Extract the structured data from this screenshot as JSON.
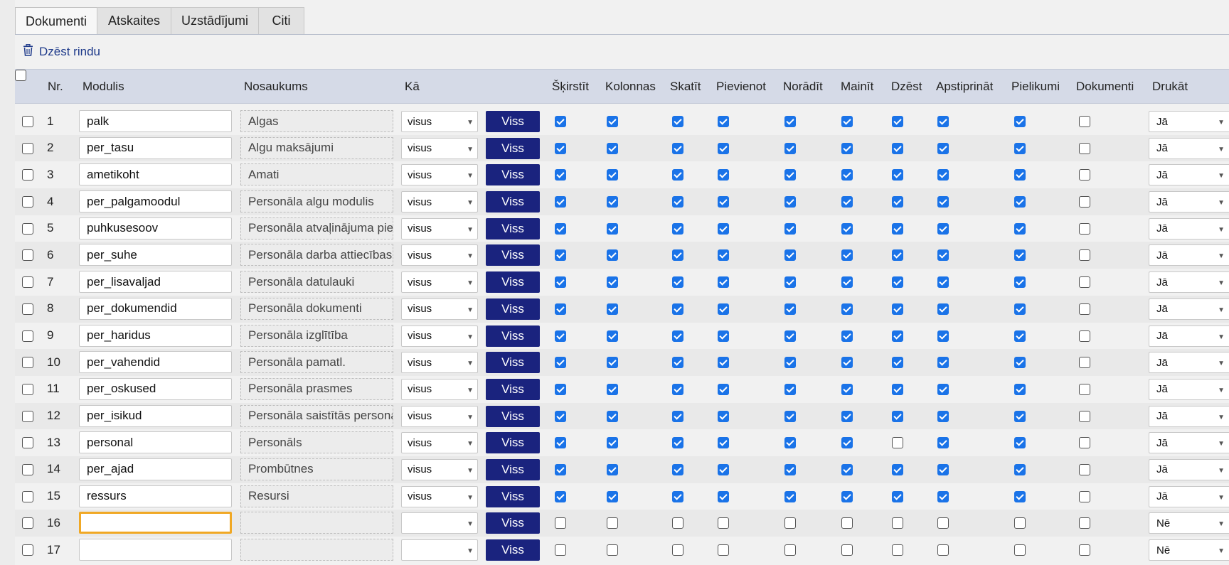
{
  "tabs": [
    "Dokumenti",
    "Atskaites",
    "Uzstādījumi",
    "Citi"
  ],
  "toolbar": {
    "delete_row_label": "Dzēst rindu",
    "icon": "trash-icon"
  },
  "columns": {
    "nr": "Nr.",
    "modulis": "Modulis",
    "nosaukums": "Nosaukums",
    "ka": "Kā",
    "perms": [
      "Šķirstīt",
      "Kolonnas",
      "Skatīt",
      "Pievienot",
      "Norādīt",
      "Mainīt",
      "Dzēst",
      "Apstiprināt",
      "Pielikumi",
      "Dokumenti"
    ],
    "drukat": "Drukāt"
  },
  "all_button_label": "Viss",
  "rows": [
    {
      "nr": "1",
      "modulis": "palk",
      "nosaukums": "Algas",
      "ka": "visus",
      "perms": [
        1,
        1,
        1,
        1,
        1,
        1,
        1,
        1,
        1,
        0
      ],
      "drukat": "Jā"
    },
    {
      "nr": "2",
      "modulis": "per_tasu",
      "nosaukums": "Algu maksājumi",
      "ka": "visus",
      "perms": [
        1,
        1,
        1,
        1,
        1,
        1,
        1,
        1,
        1,
        0
      ],
      "drukat": "Jā"
    },
    {
      "nr": "3",
      "modulis": "ametikoht",
      "nosaukums": "Amati",
      "ka": "visus",
      "perms": [
        1,
        1,
        1,
        1,
        1,
        1,
        1,
        1,
        1,
        0
      ],
      "drukat": "Jā"
    },
    {
      "nr": "4",
      "modulis": "per_palgamoodul",
      "nosaukums": "Personāla algu modulis",
      "ka": "visus",
      "perms": [
        1,
        1,
        1,
        1,
        1,
        1,
        1,
        1,
        1,
        0
      ],
      "drukat": "Jā"
    },
    {
      "nr": "5",
      "modulis": "puhkusesoov",
      "nosaukums": "Personāla atvaļinājuma pie",
      "ka": "visus",
      "perms": [
        1,
        1,
        1,
        1,
        1,
        1,
        1,
        1,
        1,
        0
      ],
      "drukat": "Jā"
    },
    {
      "nr": "6",
      "modulis": "per_suhe",
      "nosaukums": "Personāla darba attiecības",
      "ka": "visus",
      "perms": [
        1,
        1,
        1,
        1,
        1,
        1,
        1,
        1,
        1,
        0
      ],
      "drukat": "Jā"
    },
    {
      "nr": "7",
      "modulis": "per_lisavaljad",
      "nosaukums": "Personāla datulauki",
      "ka": "visus",
      "perms": [
        1,
        1,
        1,
        1,
        1,
        1,
        1,
        1,
        1,
        0
      ],
      "drukat": "Jā"
    },
    {
      "nr": "8",
      "modulis": "per_dokumendid",
      "nosaukums": "Personāla dokumenti",
      "ka": "visus",
      "perms": [
        1,
        1,
        1,
        1,
        1,
        1,
        1,
        1,
        1,
        0
      ],
      "drukat": "Jā"
    },
    {
      "nr": "9",
      "modulis": "per_haridus",
      "nosaukums": "Personāla izglītība",
      "ka": "visus",
      "perms": [
        1,
        1,
        1,
        1,
        1,
        1,
        1,
        1,
        1,
        0
      ],
      "drukat": "Jā"
    },
    {
      "nr": "10",
      "modulis": "per_vahendid",
      "nosaukums": "Personāla pamatl.",
      "ka": "visus",
      "perms": [
        1,
        1,
        1,
        1,
        1,
        1,
        1,
        1,
        1,
        0
      ],
      "drukat": "Jā"
    },
    {
      "nr": "11",
      "modulis": "per_oskused",
      "nosaukums": "Personāla prasmes",
      "ka": "visus",
      "perms": [
        1,
        1,
        1,
        1,
        1,
        1,
        1,
        1,
        1,
        0
      ],
      "drukat": "Jā"
    },
    {
      "nr": "12",
      "modulis": "per_isikud",
      "nosaukums": "Personāla saistītās persona",
      "ka": "visus",
      "perms": [
        1,
        1,
        1,
        1,
        1,
        1,
        1,
        1,
        1,
        0
      ],
      "drukat": "Jā"
    },
    {
      "nr": "13",
      "modulis": "personal",
      "nosaukums": "Personāls",
      "ka": "visus",
      "perms": [
        1,
        1,
        1,
        1,
        1,
        1,
        0,
        1,
        1,
        0
      ],
      "drukat": "Jā"
    },
    {
      "nr": "14",
      "modulis": "per_ajad",
      "nosaukums": "Prombūtnes",
      "ka": "visus",
      "perms": [
        1,
        1,
        1,
        1,
        1,
        1,
        1,
        1,
        1,
        0
      ],
      "drukat": "Jā"
    },
    {
      "nr": "15",
      "modulis": "ressurs",
      "nosaukums": "Resursi",
      "ka": "visus",
      "perms": [
        1,
        1,
        1,
        1,
        1,
        1,
        1,
        1,
        1,
        0
      ],
      "drukat": "Jā"
    },
    {
      "nr": "16",
      "modulis": "",
      "nosaukums": "",
      "ka": "",
      "perms": [
        0,
        0,
        0,
        0,
        0,
        0,
        0,
        0,
        0,
        0
      ],
      "drukat": "Nē",
      "focused": true
    },
    {
      "nr": "17",
      "modulis": "",
      "nosaukums": "",
      "ka": "",
      "perms": [
        0,
        0,
        0,
        0,
        0,
        0,
        0,
        0,
        0,
        0
      ],
      "drukat": "Nē"
    }
  ],
  "colors": {
    "focus": "#f0a825",
    "button": "#1a237e",
    "checked": "#1a73e8",
    "header": "#d5dae7"
  }
}
